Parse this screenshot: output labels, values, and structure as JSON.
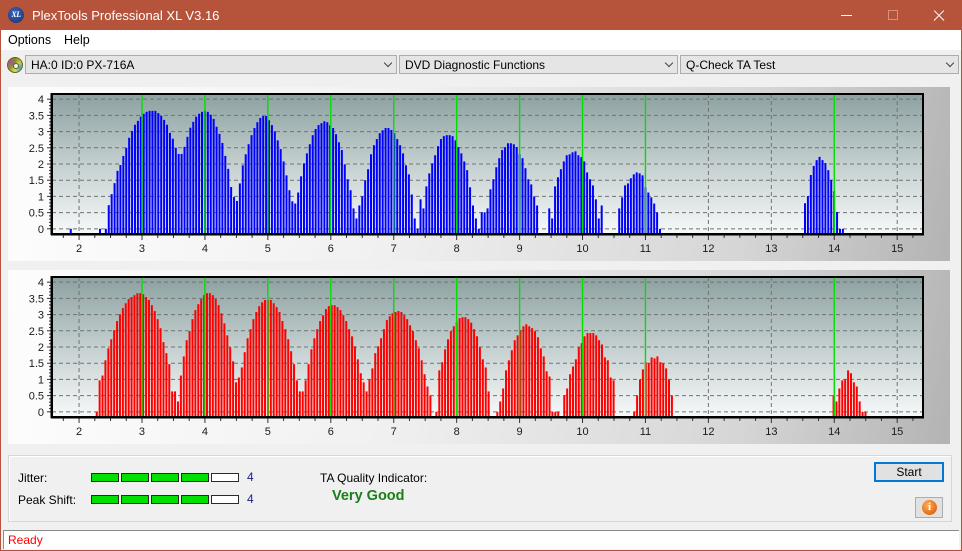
{
  "window": {
    "title": "PlexTools Professional XL V3.16",
    "logo_text": "XL",
    "controls": [
      "minimize-icon",
      "maximize-icon",
      "close-icon"
    ]
  },
  "menu": [
    {
      "label": "Options"
    },
    {
      "label": "Help"
    }
  ],
  "toolbar": {
    "drive_icon": "disc-icon",
    "drive_select": {
      "value": "HA:0 ID:0  PX-716A"
    },
    "function_select": {
      "value": "DVD Diagnostic Functions"
    },
    "test_select": {
      "value": "Q-Check TA Test"
    }
  },
  "chart_data": [
    {
      "type": "bar",
      "title": "",
      "color": "#0000ff",
      "xlim": [
        1.57,
        15.41
      ],
      "ylim": [
        -0.16,
        4.16
      ],
      "xticks": [
        2,
        3,
        4,
        5,
        6,
        7,
        8,
        9,
        10,
        11,
        12,
        13,
        14,
        15
      ],
      "xtick_labels": [
        "2",
        "3",
        "4",
        "5",
        "6",
        "7",
        "8",
        "9",
        "10",
        "11",
        "12",
        "13",
        "14",
        "15"
      ],
      "yticks": [
        0,
        0.5,
        1,
        1.5,
        2,
        2.5,
        3,
        3.5,
        4
      ],
      "ytick_labels": [
        "0",
        "0.5",
        "1",
        "1.5",
        "2",
        "2.5",
        "3",
        "3.5",
        "4"
      ],
      "x_minor_step": 0.25,
      "y_minor_step": 0.1,
      "grid": true,
      "reference_lines": [
        3,
        4,
        5,
        6,
        7,
        8,
        9,
        10,
        11,
        14
      ],
      "reference_line_color": "#00e000",
      "bar_step": 0.0463,
      "clusters": [
        {
          "x0": 1.868,
          "values": [
            0
          ]
        },
        {
          "x0": 2.333,
          "values": [
            0,
            null,
            0,
            0.73,
            1.07,
            1.41,
            1.79,
            1.97,
            2.25,
            2.5,
            2.81,
            3.02,
            3.21,
            3.33,
            3.46,
            3.55,
            3.61,
            3.64,
            3.64,
            3.64,
            3.57,
            3.49,
            3.36,
            3.21,
            2.96,
            2.78,
            2.5,
            2.31,
            2.31,
            2.53,
            2.84,
            3.12,
            3.3,
            3.46,
            3.55,
            3.61,
            3.64,
            3.61,
            3.52,
            3.39,
            3.15,
            2.93,
            2.65,
            2.25,
            1.85,
            1.29,
            0.98,
            0.86,
            1.4,
            1.96,
            2.3,
            2.61,
            2.89,
            3.11,
            3.29,
            3.42,
            3.48,
            3.48,
            3.35,
            3.2,
            3.01,
            2.73,
            2.46,
            2.08,
            1.65,
            1.19,
            0.85,
            0.78,
            1.12,
            1.62,
            2.02,
            2.33,
            2.61,
            2.89,
            3.08,
            3.2,
            3.26,
            3.32,
            3.29,
            3.2,
            3.11,
            2.92,
            2.67,
            2.43,
            1.99,
            1.53,
            1.19,
            0.63,
            0.32,
            0.72,
            1.0,
            1.5,
            1.84,
            2.3,
            2.58,
            2.77,
            2.95,
            3.04,
            3.11,
            3.11,
            3.05,
            2.95,
            2.77,
            2.58,
            2.33,
            1.96,
            1.68,
            1.06,
            0.32,
            0,
            0.91,
            0.63,
            1.31,
            1.71,
            2.02,
            2.27,
            2.55,
            2.77,
            2.86,
            2.89,
            2.89,
            2.86,
            2.73,
            2.52,
            2.33,
            2.08,
            1.81,
            1.28,
            0.72,
            0.32,
            0,
            0.51,
            0.51,
            0.63,
            1.22,
            1.53,
            1.9,
            2.18,
            2.43,
            2.52,
            2.64,
            2.64,
            2.61,
            2.52,
            2.3,
            2.18,
            1.87,
            1.53,
            1.37,
            1.0,
            0.72
          ]
        },
        {
          "x0": 9.471,
          "values": [
            0.63,
            0.32,
            1.31,
            1.59,
            1.84,
            2.08,
            2.27,
            2.3,
            2.36,
            2.39,
            2.27,
            2.21,
            2.08,
            1.74,
            1.53,
            1.34,
            0.91,
            0.32,
            0.72
          ]
        },
        {
          "x0": 10.583,
          "values": [
            0.63,
            0.97,
            1.34,
            1.4,
            1.56,
            1.68,
            1.74,
            1.71,
            1.65,
            1.28,
            1.12,
            0.97,
            0.78,
            0.51,
            0
          ]
        },
        {
          "x0": 13.535,
          "values": [
            0.79,
            1.01,
            1.66,
            1.94,
            2.12,
            2.22,
            2.12,
            2.03,
            1.81,
            1.51,
            1.16,
            0.52,
            0,
            0
          ]
        }
      ]
    },
    {
      "type": "bar",
      "title": "",
      "color": "#ff0000",
      "xlim": [
        1.57,
        15.41
      ],
      "ylim": [
        -0.16,
        4.16
      ],
      "xticks": [
        2,
        3,
        4,
        5,
        6,
        7,
        8,
        9,
        10,
        11,
        12,
        13,
        14,
        15
      ],
      "xtick_labels": [
        "2",
        "3",
        "4",
        "5",
        "6",
        "7",
        "8",
        "9",
        "10",
        "11",
        "12",
        "13",
        "14",
        "15"
      ],
      "yticks": [
        0,
        0.5,
        1,
        1.5,
        2,
        2.5,
        3,
        3.5,
        4
      ],
      "ytick_labels": [
        "0",
        "0.5",
        "1",
        "1.5",
        "2",
        "2.5",
        "3",
        "3.5",
        "4"
      ],
      "x_minor_step": 0.25,
      "y_minor_step": 0.1,
      "grid": true,
      "reference_lines": [
        3,
        4,
        5,
        6,
        7,
        8,
        9,
        10,
        11,
        14
      ],
      "reference_line_color": "#00e000",
      "bar_step": 0.0461,
      "clusters": [
        {
          "x0": 2.281,
          "values": [
            0,
            0.97,
            1.12,
            1.59,
            1.96,
            2.24,
            2.52,
            2.8,
            3.01,
            3.2,
            3.35,
            3.48,
            3.54,
            3.6,
            3.66,
            3.66,
            3.63,
            3.54,
            3.45,
            3.29,
            3.11,
            2.86,
            2.58,
            2.15,
            1.81,
            1.47,
            0.63,
            0.63,
            0.32,
            1.12,
            1.71,
            2.21,
            2.49,
            2.86,
            3.14,
            3.32,
            3.48,
            3.6,
            3.66,
            3.66,
            3.6,
            3.48,
            3.29,
            3.04,
            2.73,
            2.36,
            1.99,
            1.56,
            0.91,
            1.06,
            1.37,
            1.84,
            2.27,
            2.55,
            2.86,
            3.08,
            3.26,
            3.38,
            3.45,
            3.45,
            3.45,
            3.35,
            3.23,
            3.08,
            2.8,
            2.55,
            2.24,
            1.87,
            1.47,
            0.97,
            0.63,
            0.63,
            0.97,
            1.47,
            1.93,
            2.27,
            2.55,
            2.8,
            2.98,
            3.17,
            3.26,
            3.29,
            3.29,
            3.23,
            3.14,
            2.98,
            2.8,
            2.55,
            2.33,
            2.02,
            1.62,
            1.19,
            0.91,
            0.63,
            1.0,
            1.34,
            1.81,
            2.02,
            2.27,
            2.55,
            2.83,
            2.95,
            3.04,
            3.08,
            3.11,
            3.08,
            2.98,
            2.86,
            2.67,
            2.49,
            2.21,
            1.96,
            1.59,
            1.16,
            0.78,
            0.51
          ]
        },
        {
          "x0": 7.678,
          "values": [
            0,
            1.28,
            1.53,
            1.93,
            2.24,
            2.49,
            2.64,
            2.77,
            2.89,
            2.92,
            2.92,
            2.86,
            2.75,
            2.55,
            2.33,
            1.99,
            1.62,
            1.37,
            0.63
          ]
        },
        {
          "x0": 8.646,
          "values": [
            0,
            0.32,
            0.72,
            1.28,
            1.59,
            1.9,
            2.21,
            2.36,
            2.52,
            2.64,
            2.7,
            2.64,
            2.58,
            2.49,
            2.3,
            1.96,
            1.71,
            1.25,
            1.09,
            0,
            0,
            0
          ]
        },
        {
          "x0": 9.71,
          "values": [
            0.51,
            0.72,
            1.16,
            1.4,
            1.62,
            1.99,
            2.12,
            2.33,
            2.43,
            2.43,
            2.43,
            2.36,
            2.21,
            2.08,
            1.68,
            1.59,
            1.06,
            0.97
          ]
        },
        {
          "x0": 10.821,
          "values": [
            0,
            0.51,
            1.0,
            1.31,
            1.53,
            1.5,
            1.68,
            1.65,
            1.71,
            1.53,
            1.5,
            1.34,
            1.0,
            0.51
          ]
        },
        {
          "x0": 13.989,
          "values": [
            0.51,
            0.32,
            0.72,
            0.97,
            1.0,
            1.28,
            1.19,
            0.91,
            0.78,
            0.32,
            0,
            0
          ]
        }
      ]
    }
  ],
  "results": {
    "jitter": {
      "label": "Jitter:",
      "value": "4",
      "level": 4,
      "max": 5
    },
    "peak_shift": {
      "label": "Peak Shift:",
      "value": "4",
      "level": 4,
      "max": 5
    },
    "ta_quality_label": "TA Quality Indicator:",
    "ta_quality_value": "Very Good",
    "start_button": "Start",
    "info_button_icon": "info-icon",
    "info_glyph": "i"
  },
  "status": {
    "text": "Ready"
  },
  "colors": {
    "title_bar": "#b5533b",
    "meter_fill": "#00e000",
    "meter_empty": "#ffffff",
    "quality_text": "#1a7f1a",
    "meter_value_text": "#1a1a8c",
    "status_text": "#ff0000",
    "start_focus_border": "#0078d7"
  }
}
